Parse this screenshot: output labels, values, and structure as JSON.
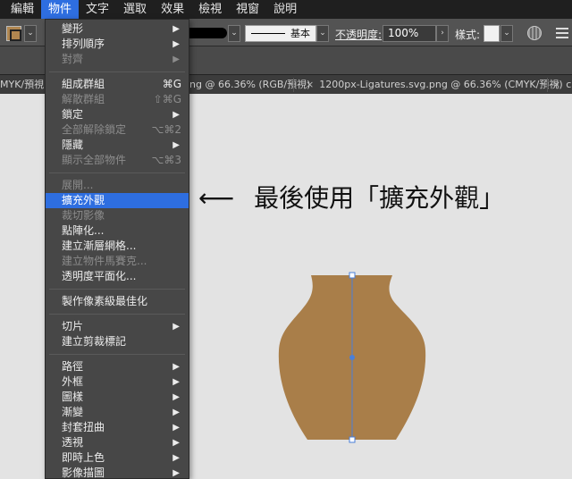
{
  "menubar": {
    "items": [
      "編輯",
      "物件",
      "文字",
      "選取",
      "效果",
      "檢視",
      "視窗",
      "說明"
    ],
    "active_index": 1
  },
  "controlbar": {
    "profile_label": "基本",
    "opacity_label": "不透明度:",
    "opacity_value": "100%",
    "style_label": "樣式:",
    "fill_color": "#b08650",
    "stroke_color": "#000000"
  },
  "tabs": [
    {
      "label": "MYK/預視)"
    },
    {
      "label": "ng @ 66.36% (RGB/預視)"
    },
    {
      "label": "1200px-Ligatures.svg.png @ 66.36% (CMYK/預視)"
    },
    {
      "label": "ca"
    }
  ],
  "menu": {
    "items": [
      {
        "type": "item",
        "label": "變形",
        "submenu": true,
        "disabled": false
      },
      {
        "type": "item",
        "label": "排列順序",
        "submenu": true,
        "disabled": false
      },
      {
        "type": "item",
        "label": "對齊",
        "submenu": true,
        "disabled": true
      },
      {
        "type": "sep"
      },
      {
        "type": "item",
        "label": "組成群組",
        "shortcut": "⌘G",
        "disabled": false
      },
      {
        "type": "item",
        "label": "解散群組",
        "shortcut": "⇧⌘G",
        "disabled": true
      },
      {
        "type": "item",
        "label": "鎖定",
        "submenu": true,
        "disabled": false
      },
      {
        "type": "item",
        "label": "全部解除鎖定",
        "shortcut": "⌥⌘2",
        "disabled": true
      },
      {
        "type": "item",
        "label": "隱藏",
        "submenu": true,
        "disabled": false
      },
      {
        "type": "item",
        "label": "顯示全部物件",
        "shortcut": "⌥⌘3",
        "disabled": true
      },
      {
        "type": "sep"
      },
      {
        "type": "item",
        "label": "展開...",
        "disabled": true
      },
      {
        "type": "item",
        "label": "擴充外觀",
        "disabled": false,
        "highlight": true
      },
      {
        "type": "item",
        "label": "裁切影像",
        "disabled": true
      },
      {
        "type": "item",
        "label": "點陣化...",
        "disabled": false
      },
      {
        "type": "item",
        "label": "建立漸層網格...",
        "disabled": false
      },
      {
        "type": "item",
        "label": "建立物件馬賽克...",
        "disabled": true
      },
      {
        "type": "item",
        "label": "透明度平面化...",
        "disabled": false
      },
      {
        "type": "sep"
      },
      {
        "type": "item",
        "label": "製作像素級最佳化",
        "disabled": false
      },
      {
        "type": "sep"
      },
      {
        "type": "item",
        "label": "切片",
        "submenu": true,
        "disabled": false
      },
      {
        "type": "item",
        "label": "建立剪裁標記",
        "disabled": false
      },
      {
        "type": "sep"
      },
      {
        "type": "item",
        "label": "路徑",
        "submenu": true,
        "disabled": false
      },
      {
        "type": "item",
        "label": "外框",
        "submenu": true,
        "disabled": false
      },
      {
        "type": "item",
        "label": "圖樣",
        "submenu": true,
        "disabled": false
      },
      {
        "type": "item",
        "label": "漸變",
        "submenu": true,
        "disabled": false
      },
      {
        "type": "item",
        "label": "封套扭曲",
        "submenu": true,
        "disabled": false
      },
      {
        "type": "item",
        "label": "透視",
        "submenu": true,
        "disabled": false
      },
      {
        "type": "item",
        "label": "即時上色",
        "submenu": true,
        "disabled": false
      },
      {
        "type": "item",
        "label": "影像描圖",
        "submenu": true,
        "disabled": false
      }
    ]
  },
  "annotation": {
    "arrow": "⟵",
    "text": "最後使用「擴充外觀」"
  },
  "vase": {
    "fill_color": "#a97e49",
    "selection_color": "#4a7fd8"
  }
}
